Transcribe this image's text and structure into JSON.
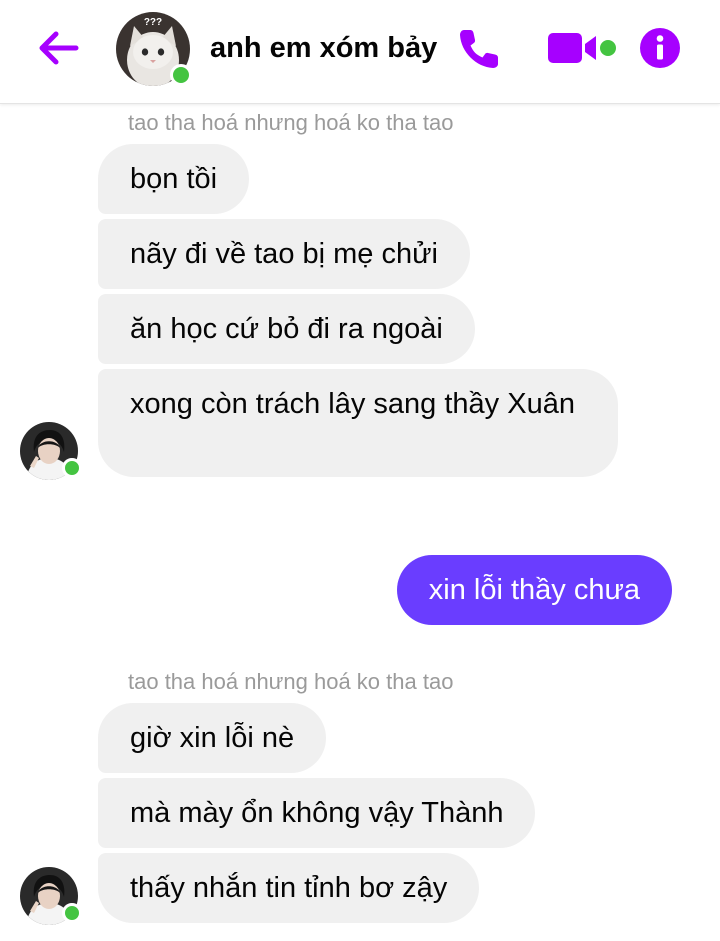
{
  "header": {
    "title": "anh em xóm bảy",
    "avatar_badge": "???",
    "accent_color": "#a600ff",
    "online_color": "#44c441",
    "icons": [
      "back-arrow-icon",
      "phone-icon",
      "video-camera-icon",
      "info-icon"
    ]
  },
  "groups": [
    {
      "sender": "tao tha hoá nhưng hoá ko tha tao",
      "messages": [
        "bọn tồi",
        "nãy đi về tao bị mẹ chửi",
        "ăn học cứ bỏ đi ra ngoài",
        "xong còn trách lây sang thầy Xuân"
      ]
    },
    {
      "sender": "tao tha hoá nhưng hoá ko tha tao",
      "messages": [
        "giờ xin lỗi nè",
        "mà mày ổn không vậy Thành",
        "thấy nhắn tin tỉnh bơ zậy"
      ]
    }
  ],
  "outgoing": {
    "messages": [
      "xin lỗi thầy chưa"
    ],
    "bubble_color": "#6a3dff"
  }
}
